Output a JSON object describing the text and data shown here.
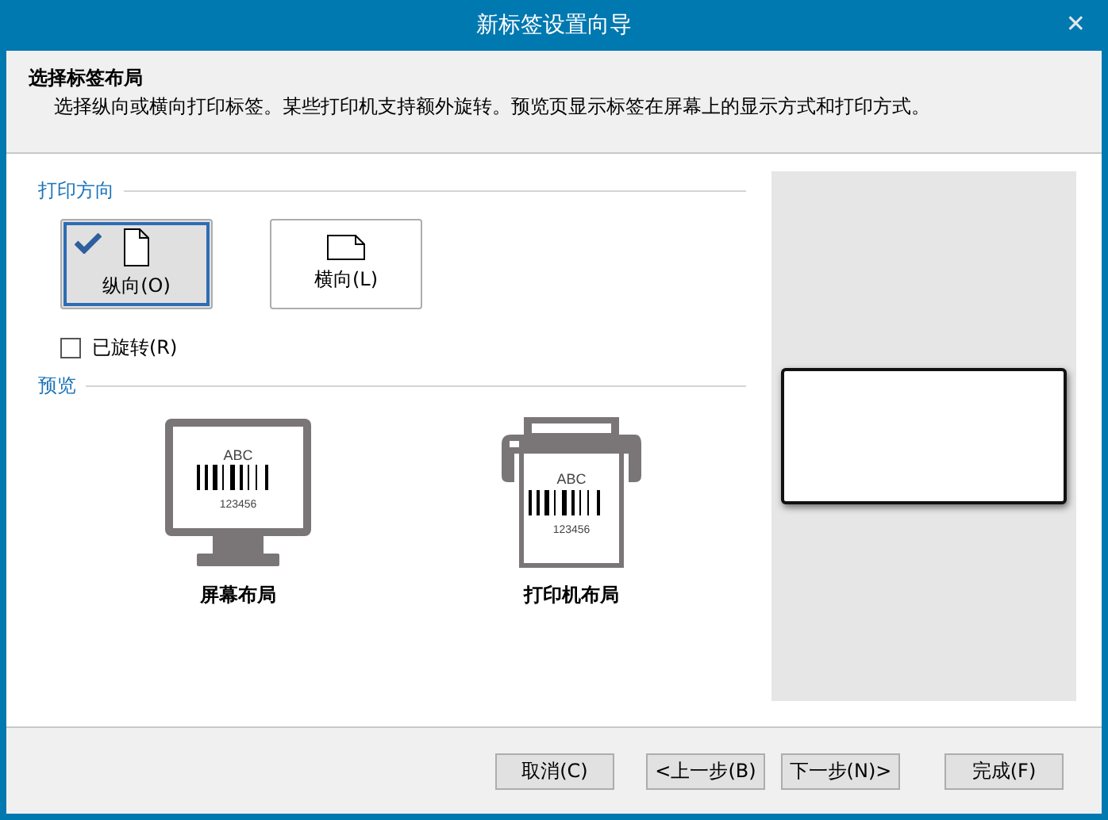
{
  "window": {
    "title": "新标签设置向导",
    "close": "✕"
  },
  "header": {
    "title": "选择标签布局",
    "description": "选择纵向或横向打印标签。某些打印机支持额外旋转。预览页显示标签在屏幕上的显示方式和打印方式。"
  },
  "orientation": {
    "heading": "打印方向",
    "options": [
      {
        "label": "纵向(O)",
        "kind": "portrait",
        "selected": true
      },
      {
        "label": "横向(L)",
        "kind": "landscape",
        "selected": false
      }
    ]
  },
  "rotated": {
    "label": "已旋转(R)",
    "checked": false
  },
  "preview": {
    "heading": "预览",
    "items": [
      {
        "kind": "screen",
        "label": "屏幕布局",
        "sample_text": "ABC",
        "sample_number": "123456"
      },
      {
        "kind": "printer",
        "label": "打印机布局",
        "sample_text": "ABC",
        "sample_number": "123456"
      }
    ]
  },
  "buttons": [
    {
      "label": "取消(C)"
    },
    {
      "label": "<上一步(B)"
    },
    {
      "label": "下一步(N)>"
    },
    {
      "label": "完成(F)"
    }
  ]
}
